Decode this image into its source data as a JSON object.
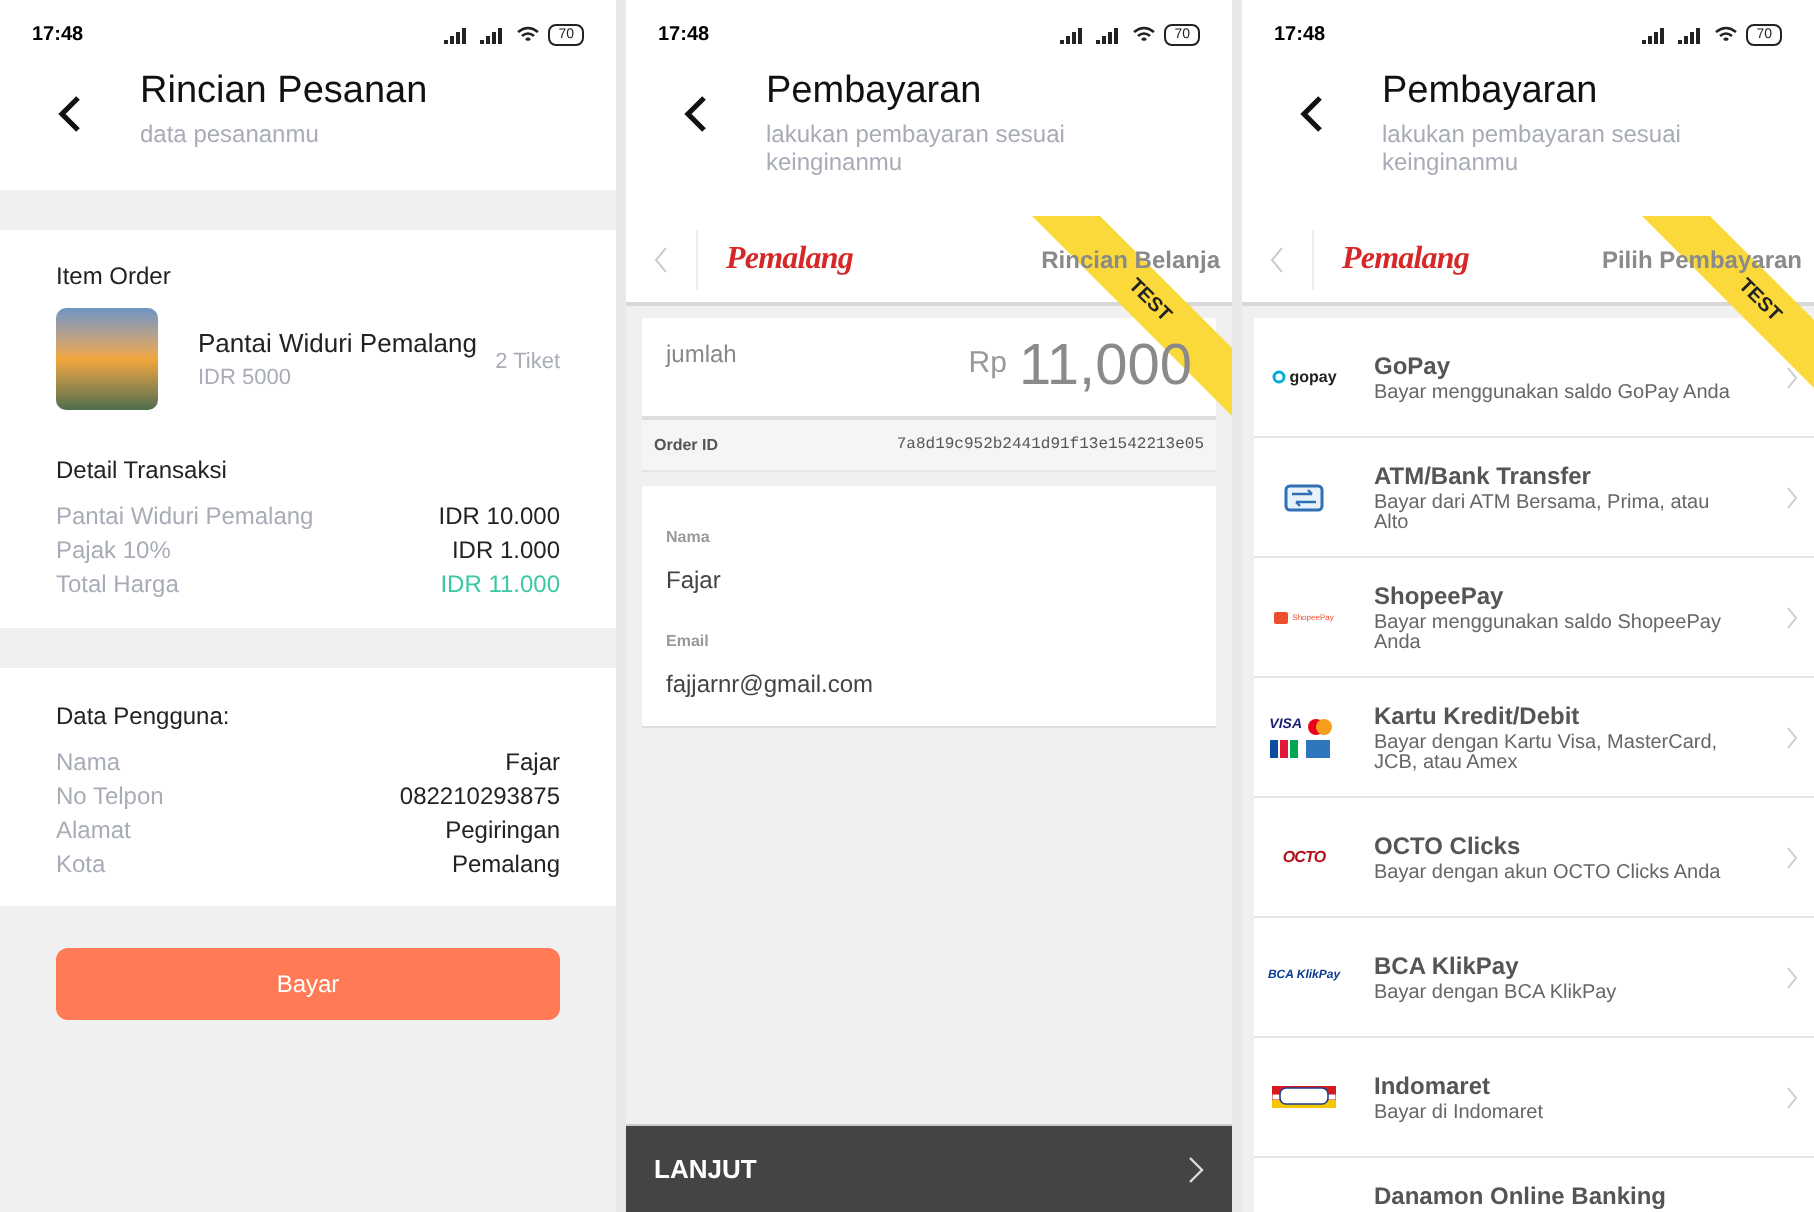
{
  "order_screen": {
    "status_bar": {
      "time": "17:48",
      "battery": "70"
    },
    "title": "Rincian Pesanan",
    "subtitle": "data pesananmu",
    "item_section": {
      "heading": "Item Order",
      "item": {
        "name": "Pantai Widuri Pemalang",
        "price": "IDR 5000",
        "quantity": "2 Tiket"
      }
    },
    "transaction": {
      "heading": "Detail Transaksi",
      "rows": [
        {
          "label": "Pantai Widuri Pemalang",
          "value": "IDR 10.000",
          "highlight": false
        },
        {
          "label": "Pajak 10%",
          "value": "IDR 1.000",
          "highlight": false
        },
        {
          "label": "Total Harga",
          "value": "IDR 11.000",
          "highlight": true
        }
      ]
    },
    "user": {
      "heading": "Data Pengguna:",
      "rows": [
        {
          "label": "Nama",
          "value": "Fajar"
        },
        {
          "label": "No Telpon",
          "value": "082210293875"
        },
        {
          "label": "Alamat",
          "value": "Pegiringan"
        },
        {
          "label": "Kota",
          "value": "Pemalang"
        }
      ]
    },
    "pay_button": "Bayar"
  },
  "payment_screen": {
    "status_bar": {
      "time": "17:48",
      "battery": "70"
    },
    "title": "Pembayaran",
    "subtitle": "lakukan pembayaran sesuai keinginanmu",
    "merchant_logo": "Pemalang",
    "page_title": "Rincian Belanja",
    "ribbon": "TEST",
    "amount_label": "jumlah",
    "currency": "Rp",
    "amount": "11,000",
    "order_id_label": "Order ID",
    "order_id": "7a8d19c952b2441d91f13e1542213e05",
    "fields": [
      {
        "label": "Nama",
        "value": "Fajar"
      },
      {
        "label": "Email",
        "value": "fajjarnr@gmail.com"
      }
    ],
    "next_button": "LANJUT"
  },
  "method_screen": {
    "status_bar": {
      "time": "17:48",
      "battery": "70"
    },
    "title": "Pembayaran",
    "subtitle": "lakukan pembayaran sesuai keinginanmu",
    "merchant_logo": "Pemalang",
    "page_title": "Pilih Pembayaran",
    "ribbon": "TEST",
    "methods": [
      {
        "kind": "gopay",
        "logo_text": "gopay",
        "name": "GoPay",
        "description": "Bayar menggunakan saldo GoPay Anda"
      },
      {
        "kind": "bank",
        "name": "ATM/Bank Transfer",
        "description": "Bayar dari ATM Bersama, Prima, atau Alto"
      },
      {
        "kind": "shopeepay",
        "logo_text": "ShopeePay",
        "name": "ShopeePay",
        "description": "Bayar menggunakan saldo ShopeePay Anda"
      },
      {
        "kind": "cards",
        "logo_text": "VISA",
        "name": "Kartu Kredit/Debit",
        "description": "Bayar dengan Kartu Visa, MasterCard, JCB, atau Amex"
      },
      {
        "kind": "octo",
        "logo_text": "OCTO",
        "name": "OCTO Clicks",
        "description": "Bayar dengan akun OCTO Clicks Anda"
      },
      {
        "kind": "bca",
        "logo_text": "BCA KlikPay",
        "name": "BCA KlikPay",
        "description": "Bayar dengan BCA KlikPay"
      },
      {
        "kind": "indomaret",
        "name": "Indomaret",
        "description": "Bayar di Indomaret"
      },
      {
        "kind": "none",
        "name": "Danamon Online Banking"
      }
    ]
  }
}
